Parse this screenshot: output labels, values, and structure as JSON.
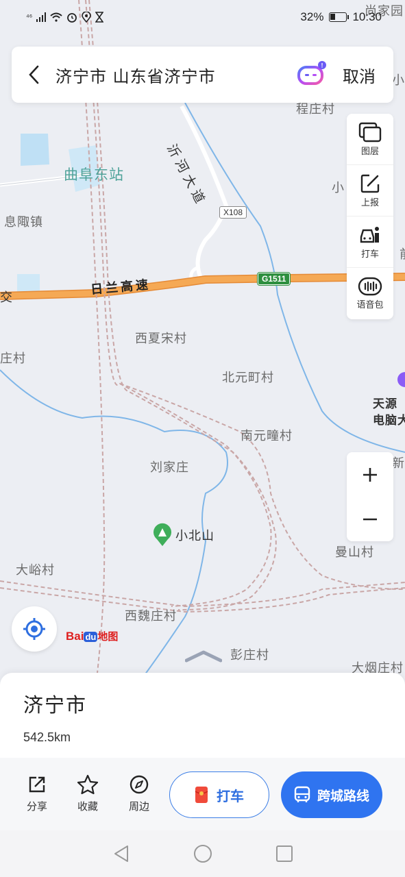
{
  "status_bar": {
    "network": "⁴⁶",
    "battery": "32%",
    "battery_level": 0.32,
    "time": "10:30"
  },
  "search": {
    "query": "济宁市 山东省济宁市",
    "cancel_label": "取消"
  },
  "map": {
    "labels": {
      "top_right_partial": "尚家园",
      "cheng_zhuang": "程庄村",
      "xiao_partial": "小",
      "xiao_partial2": "小",
      "qufu_east_station": "曲阜东站",
      "xi_zou_town": "息陬镇",
      "yihe_avenue": "沂河大道",
      "x108": "X108",
      "jiao_partial": "交",
      "rilan_expressway": "日兰高速",
      "g1511": "G1511",
      "fu_partial": "前",
      "xixia_song": "西夏宋村",
      "zhuang_partial": "庄村",
      "beiyuan_ding": "北元町村",
      "tianyuan_computer": "天源\n电脑大",
      "nanyuan_tong": "南元疃村",
      "xin_partial": "新",
      "liu_jia_zhuang": "刘家庄",
      "xiaobei_mountain": "小北山",
      "man_shan": "曼山村",
      "da_yu": "大峪村",
      "xiwei_zhuang": "西魏庄村",
      "peng_zhuang": "彭庄村",
      "da_yan_zhuang": "大烟庄村"
    }
  },
  "tools": {
    "layers": "图层",
    "report": "上报",
    "taxi": "打车",
    "voice": "语音包"
  },
  "logo": {
    "bai": "Bai",
    "du": "du",
    "ditu": "地图"
  },
  "card": {
    "title": "济宁市",
    "distance": "542.5km",
    "share": "分享",
    "favorite": "收藏",
    "nearby": "周边",
    "taxi_button": "打车",
    "route_button": "跨城路线"
  },
  "colors": {
    "accent": "#2f74f0",
    "expressway": "#f5a04a",
    "rail": "#c9a6a6",
    "water": "#7fb6e8",
    "station": "#4fa39a"
  }
}
